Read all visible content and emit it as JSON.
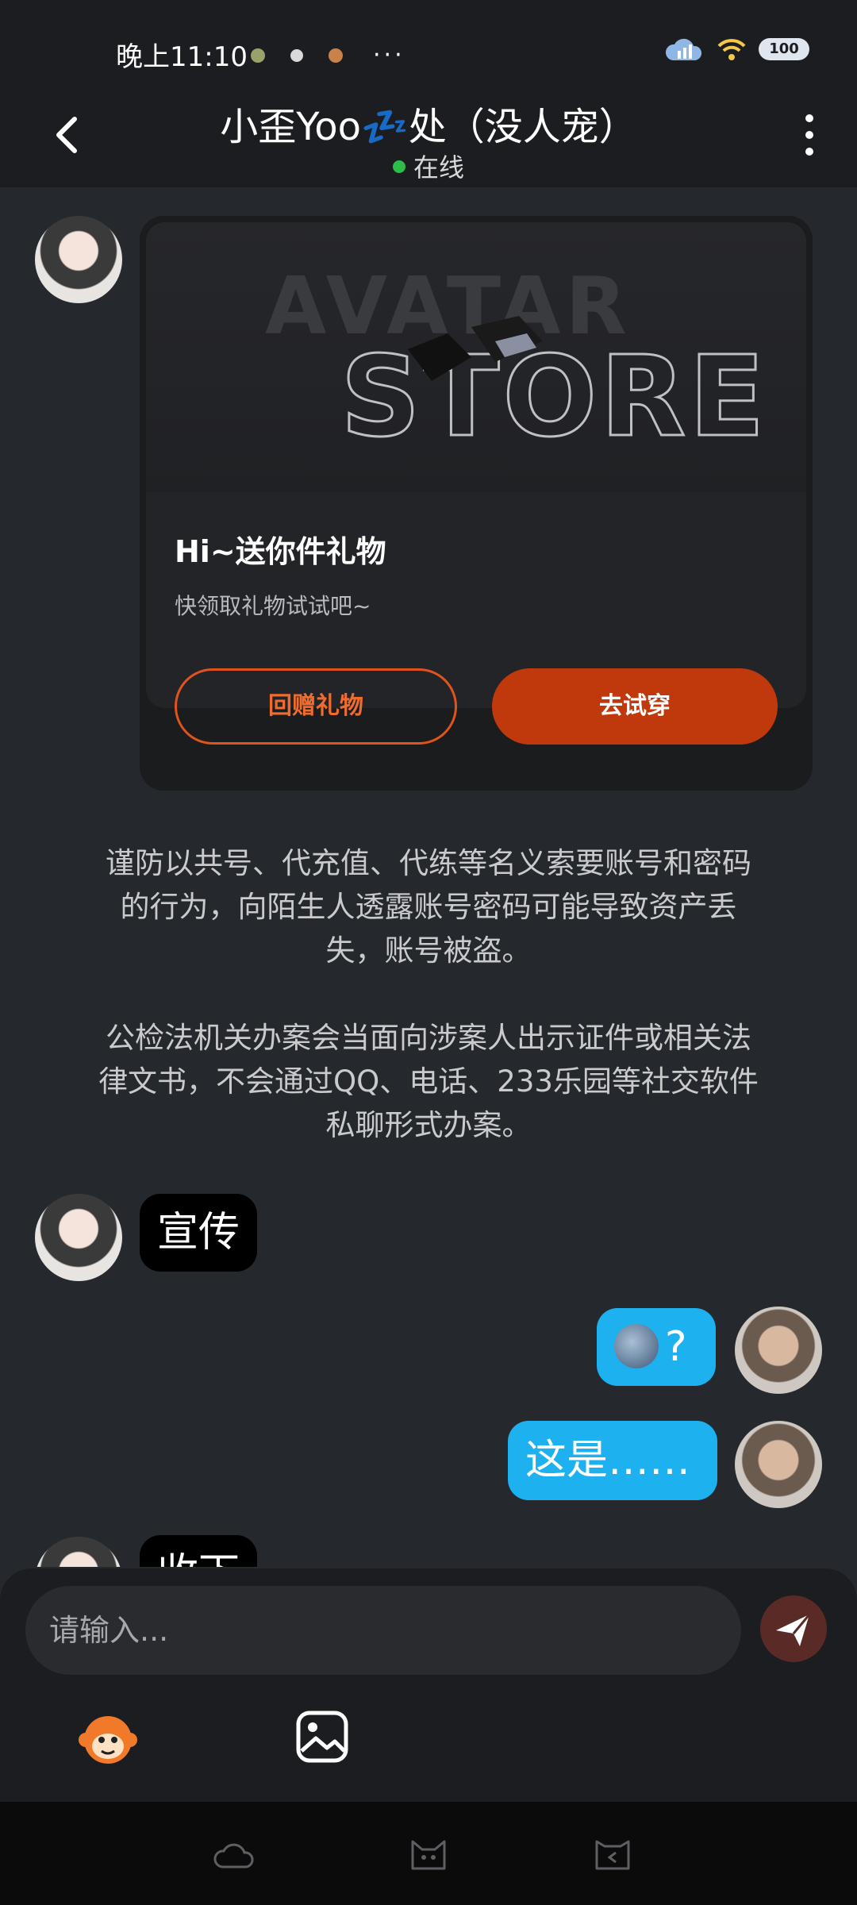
{
  "status_bar": {
    "time": "晚上11:10",
    "more": "···",
    "battery": "100"
  },
  "header": {
    "title": "小歪Yoo💤处（没人宠）",
    "status": "在线"
  },
  "gift_card": {
    "banner_line1": "AVATAR",
    "banner_line2": "STORE",
    "title": "Hi~送你件礼物",
    "subtitle": "快领取礼物试试吧~",
    "return_button": "回赠礼物",
    "try_button": "去试穿"
  },
  "notice": {
    "line1": "谨防以共号、代充值、代练等名义索要账号和密码",
    "line2": "的行为，向陌生人透露账号密码可能导致资产丢",
    "line3": "失，账号被盗。",
    "line4": "公检法机关办案会当面向涉案人出示证件或相关法",
    "line5": "律文书，不会通过QQ、电话、233乐园等社交软件",
    "line6": "私聊形式办案。"
  },
  "messages": [
    {
      "from": "other",
      "text": "宣传"
    },
    {
      "from": "me",
      "text": "?"
    },
    {
      "from": "me",
      "text": "这是……"
    },
    {
      "from": "other",
      "text": "收下"
    }
  ],
  "input": {
    "placeholder": "请输入..."
  },
  "colors": {
    "background": "#25282c",
    "bar": "#1c1d20",
    "accent_orange": "#c0390c",
    "outgoing_bubble": "#1eb1f0",
    "online": "#2bbf4a"
  },
  "icons": [
    "back-arrow-icon",
    "kebab-menu-icon",
    "send-icon",
    "monkey-emoji-icon",
    "image-icon",
    "nav-cloud-icon",
    "nav-cat-icon",
    "nav-back-icon"
  ]
}
